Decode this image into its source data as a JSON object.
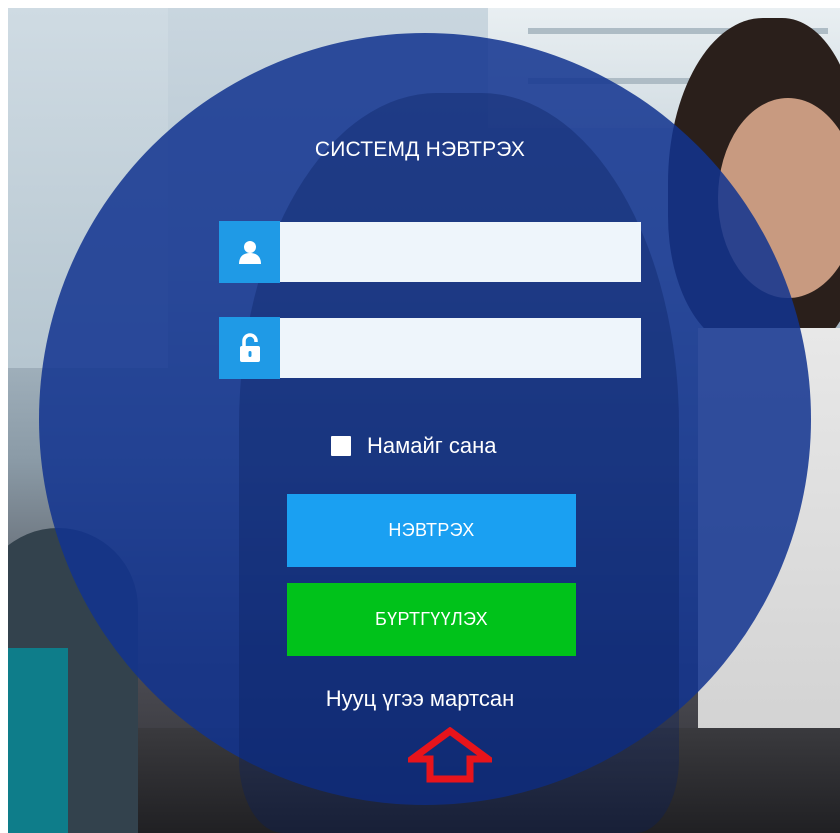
{
  "login": {
    "title": "СИСТЕМД НЭВТРЭХ",
    "username": {
      "value": "",
      "placeholder": ""
    },
    "password": {
      "value": "",
      "placeholder": ""
    },
    "remember_label": "Намайг сана",
    "remember_checked": false,
    "login_button": "НЭВТРЭХ",
    "register_button": "БҮРТГҮҮЛЭХ",
    "forgot_link": "Нууц үгээ мартсан"
  },
  "colors": {
    "circle": "#11338f",
    "field_icon_bg": "#1f9ae6",
    "login_button_bg": "#1aa0f2",
    "register_button_bg": "#00c21a",
    "arrow": "#e8141b"
  },
  "icons": {
    "username": "user-icon",
    "password": "lock-icon",
    "annotation": "up-arrow-icon"
  }
}
